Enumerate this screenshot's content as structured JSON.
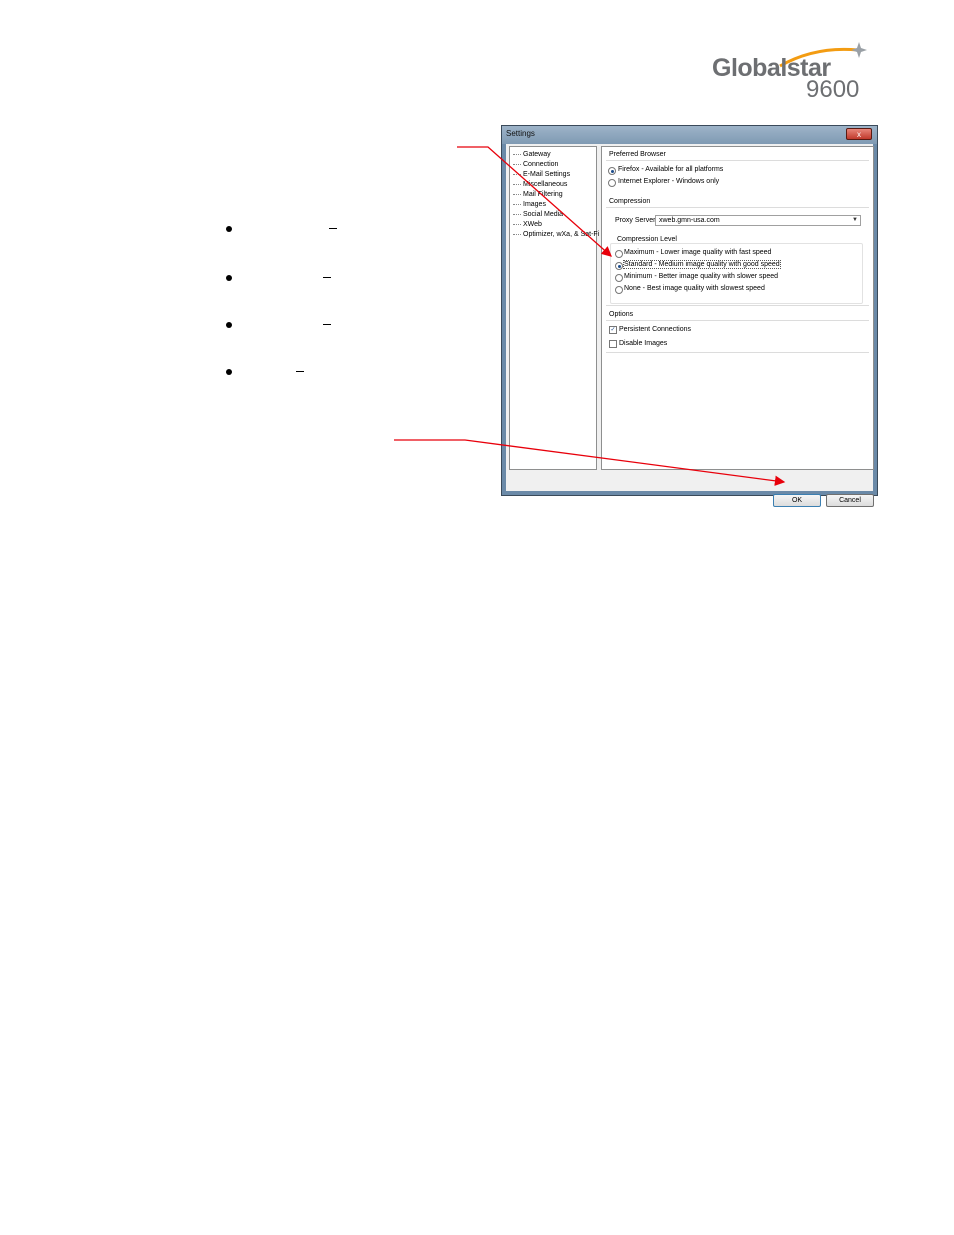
{
  "logo": {
    "word": "Globalstar",
    "model": "9600"
  },
  "dialog": {
    "title": "Settings",
    "close_label": "x",
    "tree": [
      "Gateway",
      "Connection",
      "E-Mail Settings",
      "Miscellaneous",
      "Mail Filtering",
      "Images",
      "Social Media",
      "XWeb",
      "Optimizer, wXa, & Sat-Fi"
    ],
    "preferred_browser": {
      "title": "Preferred Browser",
      "options": [
        "Firefox - Available for all platforms",
        "Internet Explorer - Windows only"
      ],
      "selected": 0
    },
    "compression": {
      "title": "Compression",
      "proxy_label": "Proxy Server",
      "proxy_value": "xweb.gmn-usa.com",
      "level_title": "Compression Level",
      "levels": [
        "Maximum - Lower image quality with fast speed",
        "Standard - Medium image quality with good speed",
        "Minimum - Better image quality with slower speed",
        "None - Best image quality with slowest speed"
      ],
      "selected": 1
    },
    "options": {
      "title": "Options",
      "persistent_label": "Persistent Connections",
      "persistent_checked": true,
      "disable_images_label": "Disable Images",
      "disable_images_checked": false
    },
    "ok_label": "OK",
    "cancel_label": "Cancel"
  },
  "colors": {
    "arrow": "#e8000b"
  }
}
